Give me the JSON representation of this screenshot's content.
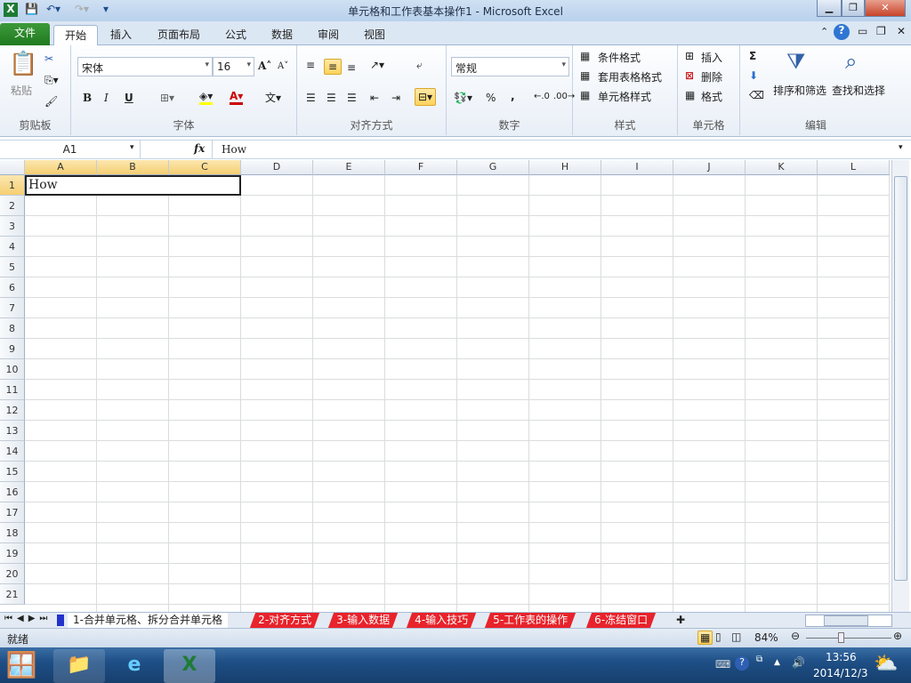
{
  "window": {
    "title": "单元格和工作表基本操作1 - Microsoft Excel"
  },
  "tabs": [
    "文件",
    "开始",
    "插入",
    "页面布局",
    "公式",
    "数据",
    "审阅",
    "视图"
  ],
  "ribbon": {
    "clipboard": {
      "paste": "粘贴",
      "label": "剪贴板"
    },
    "font": {
      "name": "宋体",
      "size": "16",
      "label": "字体",
      "bold": "B",
      "italic": "I",
      "underline": "U"
    },
    "alignment": {
      "label": "对齐方式"
    },
    "number": {
      "format": "常规",
      "label": "数字",
      "percent": "%",
      "comma": ","
    },
    "styles": {
      "conditional": "条件格式",
      "table": "套用表格格式",
      "cell": "单元格样式",
      "label": "样式"
    },
    "cells": {
      "insert": "插入",
      "delete": "删除",
      "format": "格式",
      "label": "单元格"
    },
    "editing": {
      "sum": "Σ",
      "sort": "排序和筛选",
      "find": "查找和选择",
      "label": "编辑"
    }
  },
  "formula_bar": {
    "name_box": "A1",
    "fx": "fx",
    "value": "How"
  },
  "columns": [
    "A",
    "B",
    "C",
    "D",
    "E",
    "F",
    "G",
    "H",
    "I",
    "J",
    "K",
    "L"
  ],
  "rows": [
    "1",
    "2",
    "3",
    "4",
    "5",
    "6",
    "7",
    "8",
    "9",
    "10",
    "11",
    "12",
    "13",
    "14",
    "15",
    "16",
    "17",
    "18",
    "19",
    "20",
    "21"
  ],
  "cells": {
    "A1": "How"
  },
  "sheets": [
    "1-合并单元格、拆分合并单元格",
    "2-对齐方式",
    "3-输入数据",
    "4-输入技巧",
    "5-工作表的操作",
    "6-冻结窗口"
  ],
  "status": {
    "ready": "就绪",
    "zoom": "84%"
  },
  "taskbar": {
    "time": "13:56",
    "date": "2014/12/3"
  }
}
